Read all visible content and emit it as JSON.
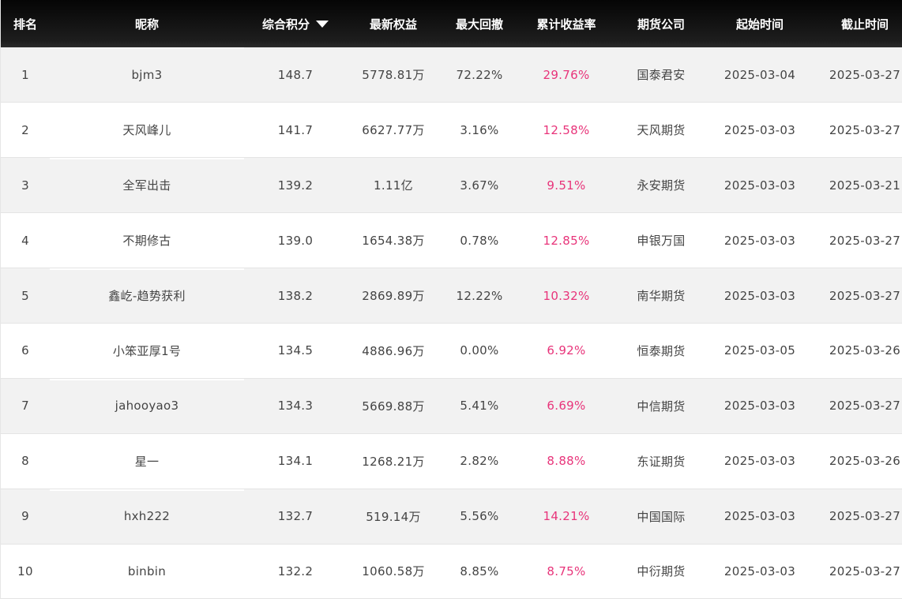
{
  "colors": {
    "header_bg": "#111111",
    "header_text": "#ffffff",
    "row_odd": "#f2f2f2",
    "row_even": "#ffffff",
    "text": "#444444",
    "positive": "#e8347a"
  },
  "header": {
    "rank": "排名",
    "nickname": "昵称",
    "score": "综合积分",
    "score_sort_icon": "caret-down-icon",
    "equity": "最新权益",
    "drawdown": "最大回撤",
    "return": "累计收益率",
    "company": "期货公司",
    "start": "起始时间",
    "end": "截止时间"
  },
  "rows": [
    {
      "rank": "1",
      "nickname": "bjm3",
      "score": "148.7",
      "equity": "5778.81万",
      "drawdown": "72.22%",
      "return": "29.76%",
      "company": "国泰君安",
      "start": "2025-03-04",
      "end": "2025-03-27"
    },
    {
      "rank": "2",
      "nickname": "天风峰儿",
      "score": "141.7",
      "equity": "6627.77万",
      "drawdown": "3.16%",
      "return": "12.58%",
      "company": "天风期货",
      "start": "2025-03-03",
      "end": "2025-03-27"
    },
    {
      "rank": "3",
      "nickname": "全军出击",
      "score": "139.2",
      "equity": "1.11亿",
      "drawdown": "3.67%",
      "return": "9.51%",
      "company": "永安期货",
      "start": "2025-03-03",
      "end": "2025-03-21"
    },
    {
      "rank": "4",
      "nickname": "不期修古",
      "score": "139.0",
      "equity": "1654.38万",
      "drawdown": "0.78%",
      "return": "12.85%",
      "company": "申银万国",
      "start": "2025-03-03",
      "end": "2025-03-27"
    },
    {
      "rank": "5",
      "nickname": "鑫屹-趋势获利",
      "score": "138.2",
      "equity": "2869.89万",
      "drawdown": "12.22%",
      "return": "10.32%",
      "company": "南华期货",
      "start": "2025-03-03",
      "end": "2025-03-27"
    },
    {
      "rank": "6",
      "nickname": "小笨亚厚1号",
      "score": "134.5",
      "equity": "4886.96万",
      "drawdown": "0.00%",
      "return": "6.92%",
      "company": "恒泰期货",
      "start": "2025-03-05",
      "end": "2025-03-26"
    },
    {
      "rank": "7",
      "nickname": "jahooyao3",
      "score": "134.3",
      "equity": "5669.88万",
      "drawdown": "5.41%",
      "return": "6.69%",
      "company": "中信期货",
      "start": "2025-03-03",
      "end": "2025-03-27"
    },
    {
      "rank": "8",
      "nickname": "星一",
      "score": "134.1",
      "equity": "1268.21万",
      "drawdown": "2.82%",
      "return": "8.88%",
      "company": "东证期货",
      "start": "2025-03-03",
      "end": "2025-03-26"
    },
    {
      "rank": "9",
      "nickname": "hxh222",
      "score": "132.7",
      "equity": "519.14万",
      "drawdown": "5.56%",
      "return": "14.21%",
      "company": "中国国际",
      "start": "2025-03-03",
      "end": "2025-03-27"
    },
    {
      "rank": "10",
      "nickname": "binbin",
      "score": "132.2",
      "equity": "1060.58万",
      "drawdown": "8.85%",
      "return": "8.75%",
      "company": "中衍期货",
      "start": "2025-03-03",
      "end": "2025-03-27"
    }
  ]
}
